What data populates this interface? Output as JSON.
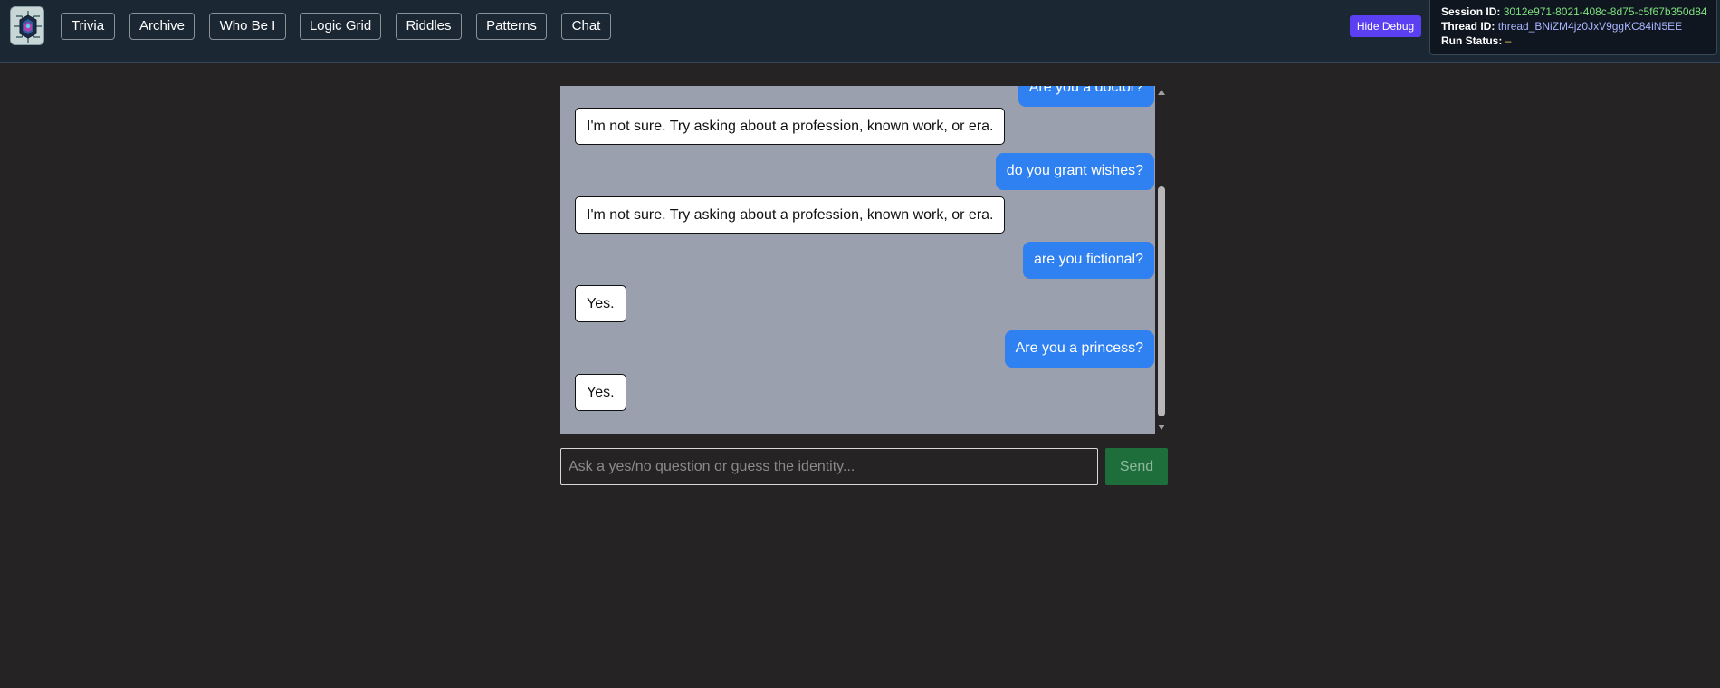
{
  "nav": {
    "items": [
      {
        "label": "Trivia"
      },
      {
        "label": "Archive"
      },
      {
        "label": "Who Be I"
      },
      {
        "label": "Logic Grid"
      },
      {
        "label": "Riddles"
      },
      {
        "label": "Patterns"
      },
      {
        "label": "Chat"
      }
    ]
  },
  "logo": {
    "icon": "circuit-brain-logo"
  },
  "debug": {
    "toggle_label": "Hide Debug",
    "session_label": "Session ID:",
    "session_value": "3012e971-8021-408c-8d75-c5f67b350d84",
    "thread_label": "Thread ID:",
    "thread_value": "thread_BNiZM4jz0JxV9ggKC84iN5EE",
    "status_label": "Run Status:",
    "status_value": "–"
  },
  "chat": {
    "messages": [
      {
        "role": "user",
        "text": "Are you a doctor?"
      },
      {
        "role": "bot",
        "text": "I'm not sure. Try asking about a profession, known work, or era."
      },
      {
        "role": "user",
        "text": "do you grant wishes?"
      },
      {
        "role": "bot",
        "text": "I'm not sure. Try asking about a profession, known work, or era."
      },
      {
        "role": "user",
        "text": "are you fictional?"
      },
      {
        "role": "bot",
        "text": "Yes."
      },
      {
        "role": "user",
        "text": "Are you a princess?"
      },
      {
        "role": "bot",
        "text": "Yes."
      }
    ]
  },
  "composer": {
    "placeholder": "Ask a yes/no question or guess the identity...",
    "value": "",
    "send_label": "Send"
  },
  "colors": {
    "topbar": "#1c2734",
    "page": "#252323",
    "chat_bg": "#9aa0ad",
    "user_bubble": "#2f80f0",
    "debug_button": "#5b3ff2",
    "send_button": "#1e6e3c"
  }
}
